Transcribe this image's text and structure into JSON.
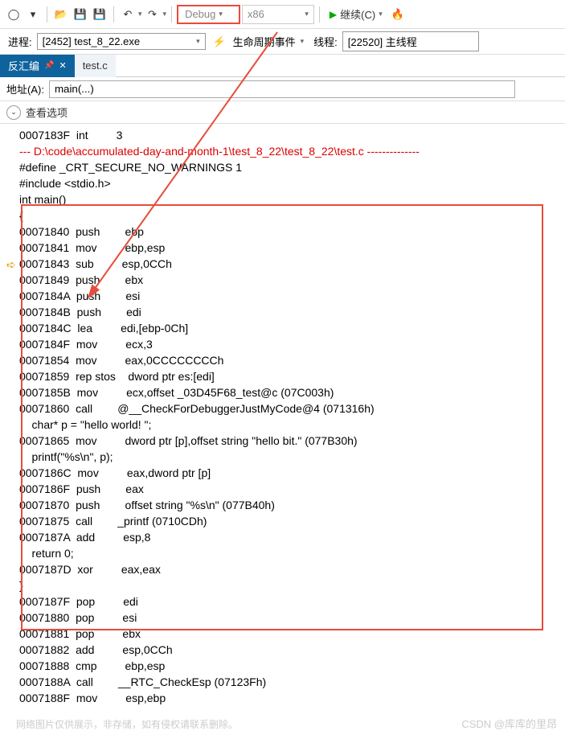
{
  "toolbar": {
    "config": "Debug",
    "platform": "x86",
    "continue_label": "继续(C)"
  },
  "row2": {
    "process_label": "进程:",
    "process_value": "[2452] test_8_22.exe",
    "lifecycle": "生命周期事件",
    "thread_label": "线程:",
    "thread_value": "[22520] 主线程"
  },
  "tabs": {
    "disasm": "反汇编",
    "file": "test.c"
  },
  "address": {
    "label": "地址(A):",
    "value": "main(...)"
  },
  "options_label": "查看选项",
  "code_lines": [
    {
      "t": "0007183F  int         3  ",
      "c": ""
    },
    {
      "t": "--- D:\\code\\accumulated-day-and-month-1\\test_8_22\\test_8_22\\test.c --------------",
      "c": "src-path"
    },
    {
      "t": "#define _CRT_SECURE_NO_WARNINGS 1",
      "c": ""
    },
    {
      "t": "",
      "c": ""
    },
    {
      "t": "#include <stdio.h>",
      "c": ""
    },
    {
      "t": "int main()",
      "c": ""
    },
    {
      "t": "{",
      "c": ""
    },
    {
      "t": "00071840  push        ebp  ",
      "c": ""
    },
    {
      "t": "00071841  mov         ebp,esp  ",
      "c": ""
    },
    {
      "t": "00071843  sub         esp,0CCh  ",
      "c": ""
    },
    {
      "t": "00071849  push        ebx  ",
      "c": ""
    },
    {
      "t": "0007184A  push        esi  ",
      "c": ""
    },
    {
      "t": "0007184B  push        edi  ",
      "c": ""
    },
    {
      "t": "0007184C  lea         edi,[ebp-0Ch]  ",
      "c": ""
    },
    {
      "t": "0007184F  mov         ecx,3  ",
      "c": ""
    },
    {
      "t": "00071854  mov         eax,0CCCCCCCCh  ",
      "c": ""
    },
    {
      "t": "00071859  rep stos    dword ptr es:[edi]  ",
      "c": ""
    },
    {
      "t": "0007185B  mov         ecx,offset _03D45F68_test@c (07C003h)  ",
      "c": ""
    },
    {
      "t": "00071860  call        @__CheckForDebuggerJustMyCode@4 (071316h)  ",
      "c": ""
    },
    {
      "t": "    char* p = \"hello world! \";",
      "c": ""
    },
    {
      "t": "00071865  mov         dword ptr [p],offset string \"hello bit.\" (077B30h)  ",
      "c": ""
    },
    {
      "t": "    printf(\"%s\\n\", p);",
      "c": ""
    },
    {
      "t": "0007186C  mov         eax,dword ptr [p]  ",
      "c": ""
    },
    {
      "t": "0007186F  push        eax  ",
      "c": ""
    },
    {
      "t": "00071870  push        offset string \"%s\\n\" (077B40h)  ",
      "c": ""
    },
    {
      "t": "00071875  call        _printf (0710CDh)  ",
      "c": ""
    },
    {
      "t": "0007187A  add         esp,8  ",
      "c": ""
    },
    {
      "t": "    return 0;",
      "c": ""
    },
    {
      "t": "0007187D  xor         eax,eax  ",
      "c": ""
    },
    {
      "t": "}",
      "c": ""
    },
    {
      "t": "0007187F  pop         edi  ",
      "c": ""
    },
    {
      "t": "00071880  pop         esi  ",
      "c": ""
    },
    {
      "t": "00071881  pop         ebx  ",
      "c": ""
    },
    {
      "t": "00071882  add         esp,0CCh  ",
      "c": ""
    },
    {
      "t": "00071888  cmp         ebp,esp  ",
      "c": ""
    },
    {
      "t": "0007188A  call        __RTC_CheckEsp (07123Fh)  ",
      "c": ""
    },
    {
      "t": "0007188F  mov         esp,ebp  ",
      "c": ""
    }
  ],
  "watermark_right": "CSDN @库库的里昂",
  "watermark_left": "网络图片仅供展示，非存储，如有侵权请联系删除。"
}
